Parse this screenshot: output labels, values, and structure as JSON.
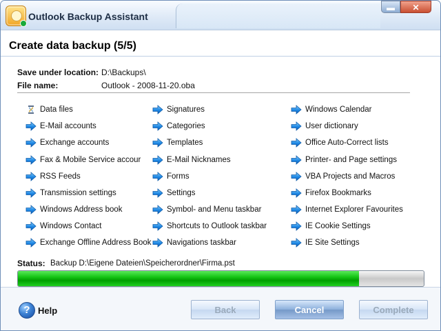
{
  "window": {
    "title": "Outlook Backup Assistant",
    "icon": "app-backup-icon",
    "controls": {
      "minimize": "minimize-icon",
      "close": "close-icon"
    }
  },
  "page": {
    "title": "Create data backup (5/5)"
  },
  "backup": {
    "location_label": "Save under location:",
    "location_value": "D:\\Backups\\",
    "file_label": "File name:",
    "file_value": "Outlook - 2008-11-20.oba"
  },
  "items": [
    {
      "label": "Data files",
      "icon": "hourglass-icon",
      "col": 0,
      "row": 0
    },
    {
      "label": "E-Mail accounts",
      "icon": "blue-arrow-icon",
      "col": 0,
      "row": 1
    },
    {
      "label": "Exchange accounts",
      "icon": "blue-arrow-icon",
      "col": 0,
      "row": 2
    },
    {
      "label": "Fax & Mobile Service accour",
      "icon": "blue-arrow-icon",
      "col": 0,
      "row": 3
    },
    {
      "label": "RSS Feeds",
      "icon": "blue-arrow-icon",
      "col": 0,
      "row": 4
    },
    {
      "label": "Transmission settings",
      "icon": "blue-arrow-icon",
      "col": 0,
      "row": 5
    },
    {
      "label": "Windows Address book",
      "icon": "blue-arrow-icon",
      "col": 0,
      "row": 6
    },
    {
      "label": "Windows Contact",
      "icon": "blue-arrow-icon",
      "col": 0,
      "row": 7
    },
    {
      "label": "Exchange Offline Address Book",
      "icon": "blue-arrow-icon",
      "col": 0,
      "row": 8
    },
    {
      "label": "Signatures",
      "icon": "blue-arrow-icon",
      "col": 1,
      "row": 0
    },
    {
      "label": "Categories",
      "icon": "blue-arrow-icon",
      "col": 1,
      "row": 1
    },
    {
      "label": "Templates",
      "icon": "blue-arrow-icon",
      "col": 1,
      "row": 2
    },
    {
      "label": "E-Mail Nicknames",
      "icon": "blue-arrow-icon",
      "col": 1,
      "row": 3
    },
    {
      "label": "Forms",
      "icon": "blue-arrow-icon",
      "col": 1,
      "row": 4
    },
    {
      "label": "Settings",
      "icon": "blue-arrow-icon",
      "col": 1,
      "row": 5
    },
    {
      "label": "Symbol- and Menu taskbar",
      "icon": "blue-arrow-icon",
      "col": 1,
      "row": 6
    },
    {
      "label": "Shortcuts to Outlook taskbar",
      "icon": "blue-arrow-icon",
      "col": 1,
      "row": 7
    },
    {
      "label": "Navigations taskbar",
      "icon": "blue-arrow-icon",
      "col": 1,
      "row": 8
    },
    {
      "label": "Windows Calendar",
      "icon": "blue-arrow-icon",
      "col": 2,
      "row": 0
    },
    {
      "label": "User dictionary",
      "icon": "blue-arrow-icon",
      "col": 2,
      "row": 1
    },
    {
      "label": "Office Auto-Correct lists",
      "icon": "blue-arrow-icon",
      "col": 2,
      "row": 2
    },
    {
      "label": "Printer- and Page settings",
      "icon": "blue-arrow-icon",
      "col": 2,
      "row": 3
    },
    {
      "label": "VBA Projects and Macros",
      "icon": "blue-arrow-icon",
      "col": 2,
      "row": 4
    },
    {
      "label": "Firefox Bookmarks",
      "icon": "blue-arrow-icon",
      "col": 2,
      "row": 5
    },
    {
      "label": "Internet Explorer Favourites",
      "icon": "blue-arrow-icon",
      "col": 2,
      "row": 6
    },
    {
      "label": "IE Cookie Settings",
      "icon": "blue-arrow-icon",
      "col": 2,
      "row": 7
    },
    {
      "label": "IE Site Settings",
      "icon": "blue-arrow-icon",
      "col": 2,
      "row": 8
    }
  ],
  "status": {
    "label": "Status:",
    "text": "Backup D:\\Eigene Dateien\\Speicherordner\\Firma.pst",
    "progress": 0.84
  },
  "help": {
    "icon": "help-icon",
    "label": "Help"
  },
  "buttons": {
    "back": "Back",
    "cancel": "Cancel",
    "complete": "Complete"
  },
  "colors": {
    "accent_blue": "#1e88e5",
    "progress_green": "#18c418",
    "window_border": "#6f8fb8"
  }
}
